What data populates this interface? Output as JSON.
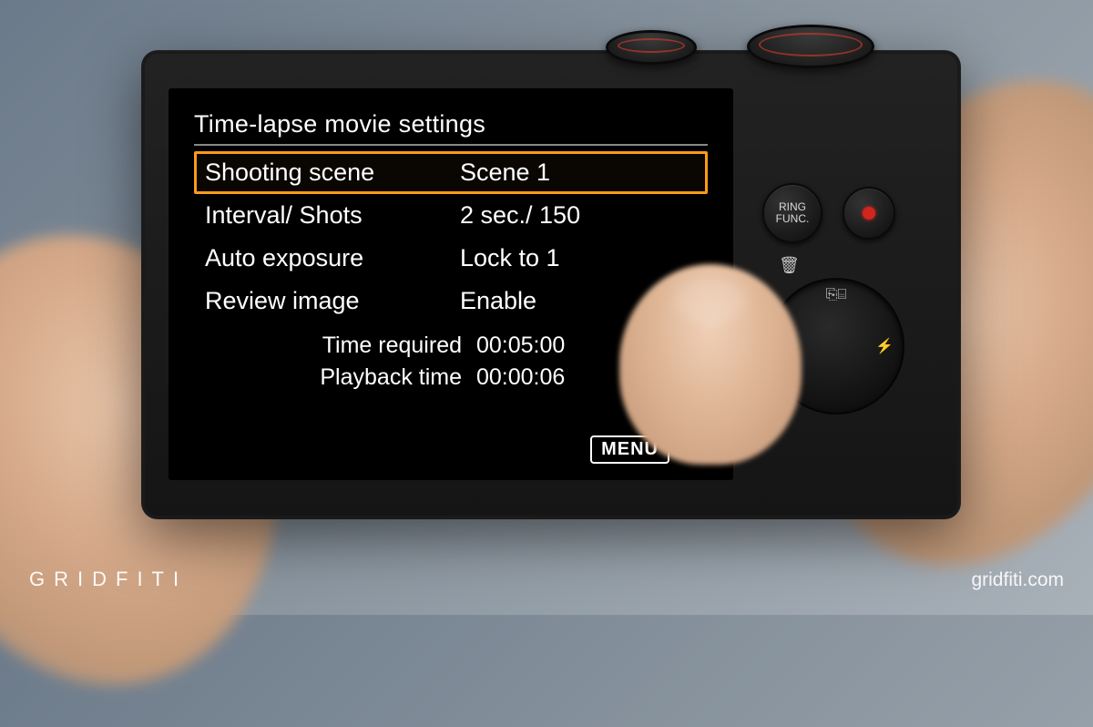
{
  "menu": {
    "title": "Time-lapse movie settings",
    "items": [
      {
        "label": "Shooting scene",
        "value": "Scene 1",
        "selected": true
      },
      {
        "label": "Interval/ Shots",
        "value": "2 sec./ 150",
        "selected": false
      },
      {
        "label": "Auto exposure",
        "value": "Lock to 1",
        "selected": false
      },
      {
        "label": "Review image",
        "value": "Enable",
        "selected": false
      }
    ],
    "summary": [
      {
        "label": "Time required",
        "value": "00:05:00"
      },
      {
        "label": "Playback time",
        "value": "00:00:06"
      }
    ],
    "back_label": "MENU"
  },
  "buttons": {
    "ring_func": "RING\nFUNC.",
    "trash_icon": "🗑",
    "wheel_top_icon": "⎘⌸",
    "wheel_right_icon": "⚡"
  },
  "watermark": {
    "left": "GRIDFITI",
    "right": "gridfiti.com"
  }
}
